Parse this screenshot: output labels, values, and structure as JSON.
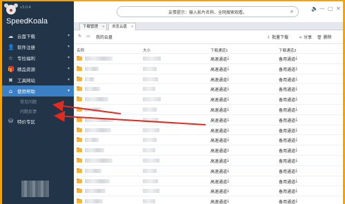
{
  "app": {
    "version": "v3.0.4",
    "brand": "SpeedKoala",
    "search": {
      "placeholder": "友情提示：输入影片名称、全网搜索观看。",
      "icon": "search-icon"
    },
    "window_controls": {
      "volume": "🔈",
      "minimize": "—",
      "maximize": "▢",
      "close": "✕"
    }
  },
  "sidebar": {
    "items": [
      {
        "label": "云盘下载",
        "icon": "cloud-download-icon",
        "glyph": "☁"
      },
      {
        "label": "软件注册",
        "icon": "user-icon",
        "glyph": "👤"
      },
      {
        "label": "专拉福利",
        "icon": "star-icon",
        "glyph": "☆"
      },
      {
        "label": "精品资源",
        "icon": "gift-icon",
        "glyph": "🎁"
      },
      {
        "label": "工具网站",
        "icon": "tools-icon",
        "glyph": "✖"
      },
      {
        "label": "使用帮助",
        "icon": "tag-icon",
        "glyph": "⌂"
      }
    ],
    "sub_items": [
      "常见问题",
      "问题反馈"
    ],
    "extra": {
      "label": "特价专区",
      "glyph": "⛁"
    }
  },
  "tabs": [
    {
      "label": "下载管理"
    },
    {
      "label": "浏览云盘"
    }
  ],
  "toolbar": {
    "my_cloud": "我的云盘",
    "batch_download": "批量下载",
    "share": "分享",
    "delete": "删除"
  },
  "table": {
    "headers": {
      "name": "名称",
      "size": "大小",
      "channel1": "下载通道1",
      "channel2": "下载通道2"
    },
    "channel1_label": "高速通道",
    "channel2_label": "备用通道",
    "rows": [
      {
        "name": "",
        "size": ""
      },
      {
        "name": "",
        "size": ""
      },
      {
        "name": "",
        "size": ""
      },
      {
        "name": "",
        "size": ""
      },
      {
        "name": "",
        "size": ""
      },
      {
        "name": "",
        "size": ""
      },
      {
        "name": "",
        "size": ""
      },
      {
        "name": "",
        "size": ""
      },
      {
        "name": "",
        "size": ""
      },
      {
        "name": "",
        "size": ""
      },
      {
        "name": "",
        "size": ""
      },
      {
        "name": "",
        "size": ""
      },
      {
        "name": "",
        "size": ""
      },
      {
        "name": "",
        "size": ""
      },
      {
        "name": "",
        "size": ""
      }
    ]
  },
  "colors": {
    "sidebar": "#223447",
    "active": "#3b7fc4",
    "frame": "#f2a20c",
    "arrow": "#e02b20"
  }
}
